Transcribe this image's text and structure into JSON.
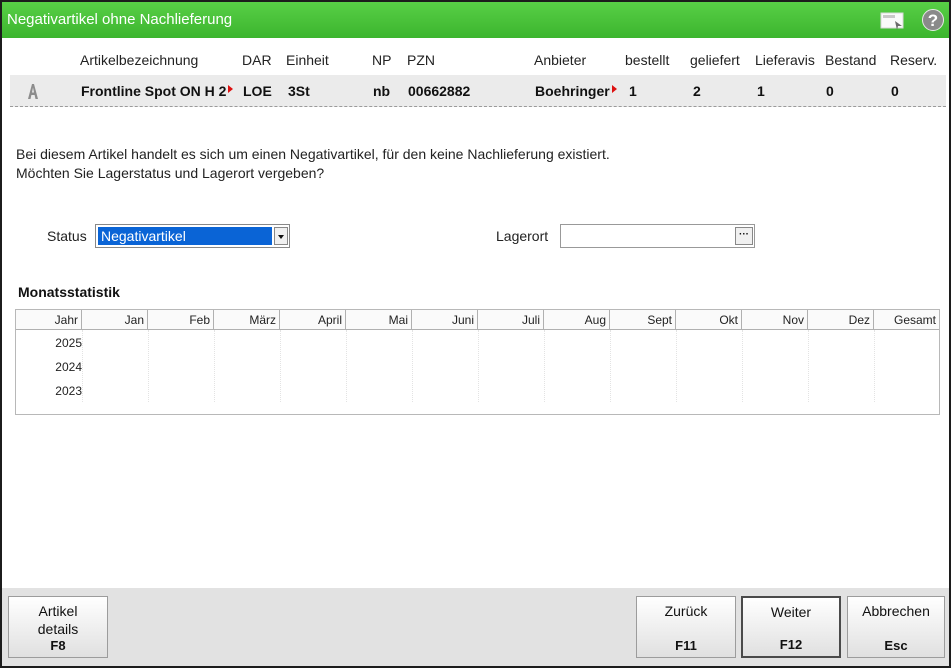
{
  "window": {
    "title": "Negativartikel ohne Nachlieferung"
  },
  "columns": {
    "artikel": "Artikelbezeichnung",
    "dar": "DAR",
    "einheit": "Einheit",
    "np": "NP",
    "pzn": "PZN",
    "anbieter": "Anbieter",
    "bestellt": "bestellt",
    "geliefert": "geliefert",
    "lieferavis": "Lieferavis",
    "bestand": "Bestand",
    "reserv": "Reserv."
  },
  "article": {
    "name": "Frontline Spot ON H 2",
    "dar": "LOE",
    "einheit": "3St",
    "np": "nb",
    "pzn": "00662882",
    "anbieter": "Boehringer",
    "bestellt": "1",
    "geliefert": "2",
    "lieferavis": "1",
    "bestand": "0",
    "reserv": "0"
  },
  "message": {
    "line1": "Bei diesem Artikel handelt es sich um einen Negativartikel, für den keine Nachlieferung existiert.",
    "line2": "Möchten Sie Lagerstatus und Lagerort vergeben?"
  },
  "form": {
    "status_label": "Status",
    "status_value": "Negativartikel",
    "lagerort_label": "Lagerort",
    "lagerort_value": "",
    "lagerort_btn": "···"
  },
  "stats": {
    "title": "Monatsstatistik",
    "headers": [
      "Jahr",
      "Jan",
      "Feb",
      "März",
      "April",
      "Mai",
      "Juni",
      "Juli",
      "Aug",
      "Sept",
      "Okt",
      "Nov",
      "Dez",
      "Gesamt"
    ],
    "years": [
      "2025",
      "2024",
      "2023"
    ]
  },
  "footer": {
    "details_line1": "Artikel",
    "details_line2": "details",
    "details_key": "F8",
    "back_label": "Zurück",
    "back_key": "F11",
    "next_label": "Weiter",
    "next_key": "F12",
    "cancel_label": "Abbrechen",
    "cancel_key": "Esc"
  },
  "icons": {
    "titlebar": "window-layout-icon",
    "help": "help-icon",
    "article": "pharmacy-a-icon"
  },
  "colors": {
    "titlebar": "#45be34",
    "selection": "#0a64d6",
    "footer": "#e2e2e2"
  }
}
